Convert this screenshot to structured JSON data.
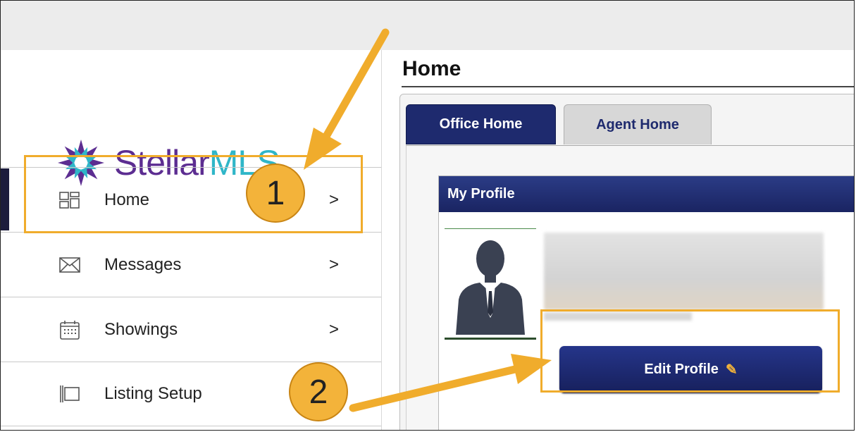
{
  "brand": {
    "logo_name": "Stellar",
    "logo_suffix": "MLS",
    "primary_color": "#5c2d91",
    "accent_color": "#2fb6c8"
  },
  "sidebar": {
    "items": [
      {
        "label": "Home",
        "chevron": ">",
        "icon": "dashboard-icon"
      },
      {
        "label": "Messages",
        "chevron": ">",
        "icon": "envelope-icon"
      },
      {
        "label": "Showings",
        "chevron": ">",
        "icon": "calendar-icon"
      },
      {
        "label": "Listing Setup",
        "chevron": "",
        "icon": "flag-icon"
      }
    ]
  },
  "main": {
    "title": "Home",
    "tabs": [
      {
        "label": "Office Home",
        "active": true
      },
      {
        "label": "Agent Home",
        "active": false
      }
    ],
    "profile_card": {
      "header": "My Profile",
      "edit_button": "Edit Profile"
    }
  },
  "annotations": {
    "step1": "1",
    "step2": "2",
    "highlight_color": "#f0ac2c"
  }
}
